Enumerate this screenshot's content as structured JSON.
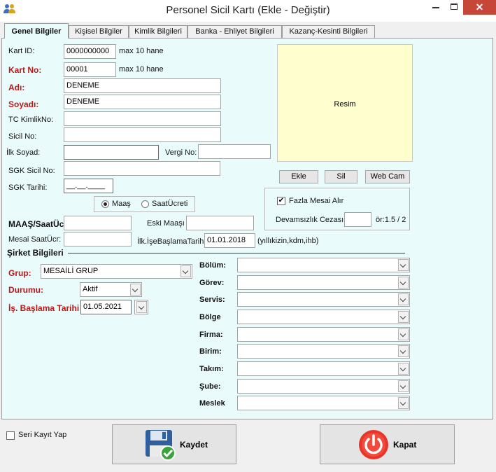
{
  "window": {
    "title": "Personel Sicil Kartı (Ekle - Değiştir)",
    "minimize_icon": "minimize-icon",
    "maximize_icon": "maximize-icon",
    "close_glyph": "✕"
  },
  "tabs": [
    {
      "label": "Genel Bilgiler",
      "active": true
    },
    {
      "label": "Kişisel Bilgiler"
    },
    {
      "label": "Kimlik Bilgileri"
    },
    {
      "label": "Banka - Ehliyet Bilgileri"
    },
    {
      "label": "Kazanç-Kesinti Bilgileri"
    }
  ],
  "form": {
    "kart_id": {
      "label": "Kart ID:",
      "value": "0000000000",
      "hint": "max 10 hane"
    },
    "kart_no": {
      "label": "Kart No:",
      "value": "00001",
      "hint": "max 10 hane"
    },
    "adi": {
      "label": "Adı:",
      "value": "DENEME"
    },
    "soyadi": {
      "label": "Soyadı:",
      "value": "DENEME"
    },
    "tc_kimlik": {
      "label": "TC KimlikNo:",
      "value": ""
    },
    "sicil_no": {
      "label": "Sicil No:",
      "value": ""
    },
    "ilk_soyad": {
      "label": "İlk Soyad:",
      "value": ""
    },
    "vergi_no": {
      "label": "Vergi No:",
      "value": ""
    },
    "sgk_sicil": {
      "label": "SGK Sicil No:",
      "value": ""
    },
    "sgk_tarihi": {
      "label": "SGK Tarihi:",
      "value": "__.__.____"
    },
    "pay_type": {
      "option1": "Maaş",
      "option2": "SaatÜcreti",
      "selected": "Maaş"
    },
    "maas": {
      "label": "MAAŞ/SaatÜc",
      "value": ""
    },
    "eski_maas": {
      "label": "Eski Maaşı",
      "value": ""
    },
    "mesai_saat": {
      "label": "Mesai SaatÜcr:",
      "value": ""
    },
    "ilk_ise_baslama": {
      "label": "İlk.İşeBaşlamaTarihi",
      "value": "01.01.2018",
      "hint": "(yıllıkizin,kdm,ihb)"
    }
  },
  "photo": {
    "placeholder": "Resim",
    "add_label": "Ekle",
    "delete_label": "Sil",
    "webcam_label": "Web Cam"
  },
  "overtime": {
    "fazla_mesai_label": "Fazla Mesai Alır",
    "fazla_mesai_checked": true,
    "devamsizlik_label": "Devamsızlık Cezası:",
    "devamsizlik_value": "",
    "ratio_text": "ör:1.5 / 2"
  },
  "company": {
    "section_title": "Şirket Bilgileri",
    "grup": {
      "label": "Grup:",
      "value": "MESAİLİ GRUP"
    },
    "durumu": {
      "label": "Durumu:",
      "value": "Aktif"
    },
    "is_baslama": {
      "label": "İş. Başlama Tarihi",
      "value": "01.05.2021"
    },
    "right_fields": [
      {
        "label": "Bölüm:",
        "value": ""
      },
      {
        "label": "Görev:",
        "value": ""
      },
      {
        "label": "Servis:",
        "value": ""
      },
      {
        "label": "Bölge",
        "value": ""
      },
      {
        "label": "Firma:",
        "value": ""
      },
      {
        "label": "Birim:",
        "value": ""
      },
      {
        "label": "Takım:",
        "value": ""
      },
      {
        "label": "Şube:",
        "value": ""
      },
      {
        "label": "Meslek",
        "value": ""
      }
    ]
  },
  "footer": {
    "seri_kayit_label": "Seri Kayıt Yap",
    "seri_kayit_checked": false,
    "save_label": "Kaydet",
    "close_label": "Kapat",
    "save_icon": "floppy-disk-check-icon",
    "close_icon": "power-icon",
    "colors": {
      "power_red": "#e8352a",
      "floppy_blue": "#2f5f9e",
      "check_green": "#3aa33a"
    }
  }
}
